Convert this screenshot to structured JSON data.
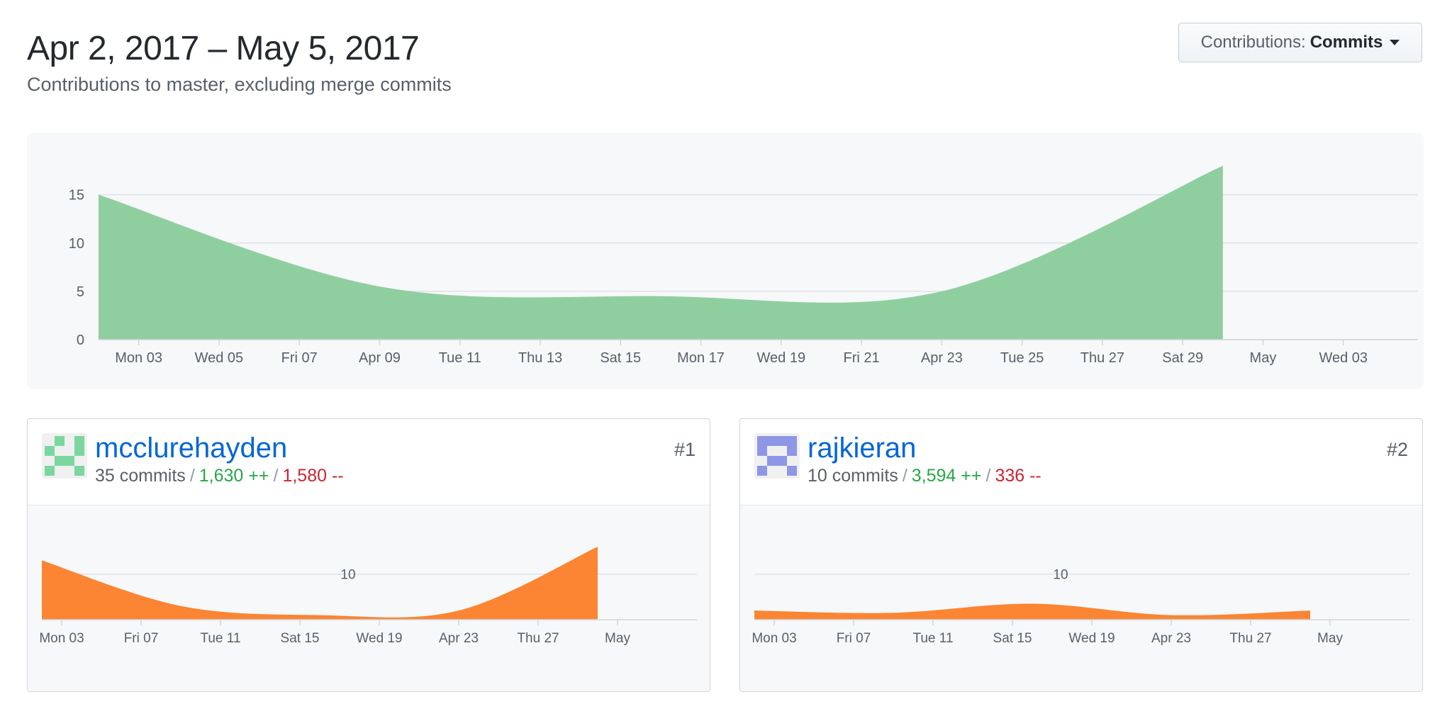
{
  "header": {
    "title": "Apr 2, 2017 – May 5, 2017",
    "subtitle": "Contributions to master, excluding merge commits"
  },
  "contributions_button": {
    "label": "Contributions:",
    "value": "Commits"
  },
  "colors": {
    "main_area": "#8fcf9f",
    "contributor_area": "#fb8532",
    "link": "#0366d6",
    "additions": "#28a745",
    "deletions": "#cb2431"
  },
  "contributors": [
    {
      "username": "mcclurehayden",
      "commits": "35 commits",
      "additions": "1,630 ++",
      "deletions": "1,580 --",
      "rank": "#1",
      "avatar_color": "#7bd6a0"
    },
    {
      "username": "rajkieran",
      "commits": "10 commits",
      "additions": "3,594 ++",
      "deletions": "336 --",
      "rank": "#2",
      "avatar_color": "#8e96e6"
    }
  ],
  "chart_data": [
    {
      "type": "area",
      "name": "overall",
      "x_start": "2017-04-02",
      "x_end": "2017-05-05",
      "xtick_labels": [
        "Mon 03",
        "Wed 05",
        "Fri 07",
        "Apr 09",
        "Tue 11",
        "Thu 13",
        "Sat 15",
        "Mon 17",
        "Wed 19",
        "Fri 21",
        "Apr 23",
        "Tue 25",
        "Thu 27",
        "Sat 29",
        "May",
        "Wed 03"
      ],
      "xtick_dates": [
        "2017-04-03",
        "2017-04-05",
        "2017-04-07",
        "2017-04-09",
        "2017-04-11",
        "2017-04-13",
        "2017-04-15",
        "2017-04-17",
        "2017-04-19",
        "2017-04-21",
        "2017-04-23",
        "2017-04-25",
        "2017-04-27",
        "2017-04-29",
        "2017-05-01",
        "2017-05-03"
      ],
      "yticks": [
        0,
        5,
        10,
        15
      ],
      "ylim": [
        0,
        18.5
      ],
      "grid": true,
      "x": [
        "2017-04-02",
        "2017-04-09",
        "2017-04-16",
        "2017-04-23",
        "2017-04-30"
      ],
      "values": [
        15,
        5.5,
        4.5,
        5,
        18
      ]
    },
    {
      "type": "area",
      "name": "mcclurehayden",
      "x_start": "2017-04-02",
      "x_end": "2017-05-05",
      "xtick_labels": [
        "Mon 03",
        "Fri 07",
        "Tue 11",
        "Sat 15",
        "Wed 19",
        "Apr 23",
        "Thu 27",
        "May"
      ],
      "xtick_dates": [
        "2017-04-03",
        "2017-04-07",
        "2017-04-11",
        "2017-04-15",
        "2017-04-19",
        "2017-04-23",
        "2017-04-27",
        "2017-05-01"
      ],
      "yticks": [
        10
      ],
      "ylim": [
        0,
        14
      ],
      "grid": true,
      "x": [
        "2017-04-02",
        "2017-04-09",
        "2017-04-16",
        "2017-04-23",
        "2017-04-30"
      ],
      "values": [
        13,
        3,
        1,
        2,
        16
      ]
    },
    {
      "type": "area",
      "name": "rajkieran",
      "x_start": "2017-04-02",
      "x_end": "2017-05-05",
      "xtick_labels": [
        "Mon 03",
        "Fri 07",
        "Tue 11",
        "Sat 15",
        "Wed 19",
        "Apr 23",
        "Thu 27",
        "May"
      ],
      "xtick_dates": [
        "2017-04-03",
        "2017-04-07",
        "2017-04-11",
        "2017-04-15",
        "2017-04-19",
        "2017-04-23",
        "2017-04-27",
        "2017-05-01"
      ],
      "yticks": [
        10
      ],
      "ylim": [
        0,
        14
      ],
      "grid": true,
      "x": [
        "2017-04-02",
        "2017-04-09",
        "2017-04-16",
        "2017-04-23",
        "2017-04-30"
      ],
      "values": [
        2,
        1.5,
        3.5,
        1,
        2
      ]
    }
  ]
}
